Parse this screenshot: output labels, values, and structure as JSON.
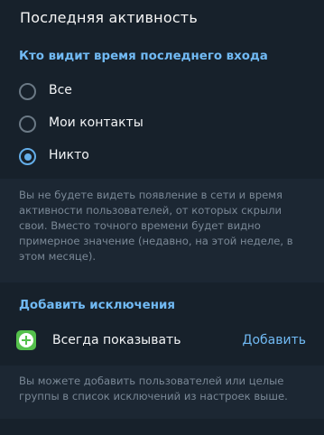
{
  "header": {
    "title": "Последняя активность"
  },
  "visibility": {
    "section_title": "Кто видит время последнего входа",
    "options": [
      {
        "label": "Все",
        "checked": false
      },
      {
        "label": "Мои контакты",
        "checked": false
      },
      {
        "label": "Никто",
        "checked": true
      }
    ],
    "note": "Вы не будете видеть появление в сети и время\nактивности пользователей, от которых скрыли\nсвои. Вместо точного времени будет видно\nпримерное значение (недавно, на этой неделе, в\nэтом месяце)."
  },
  "exceptions": {
    "section_title": "Добавить исключения",
    "always_show_label": "Всегда показывать",
    "add_label": "Добавить",
    "note": "Вы можете добавить пользователей или целые\nгруппы в список исключений из настроек выше."
  },
  "colors": {
    "accent": "#71baf4",
    "background": "#17212b",
    "note_background": "#1c2733",
    "icon_green": "#55c14c"
  }
}
